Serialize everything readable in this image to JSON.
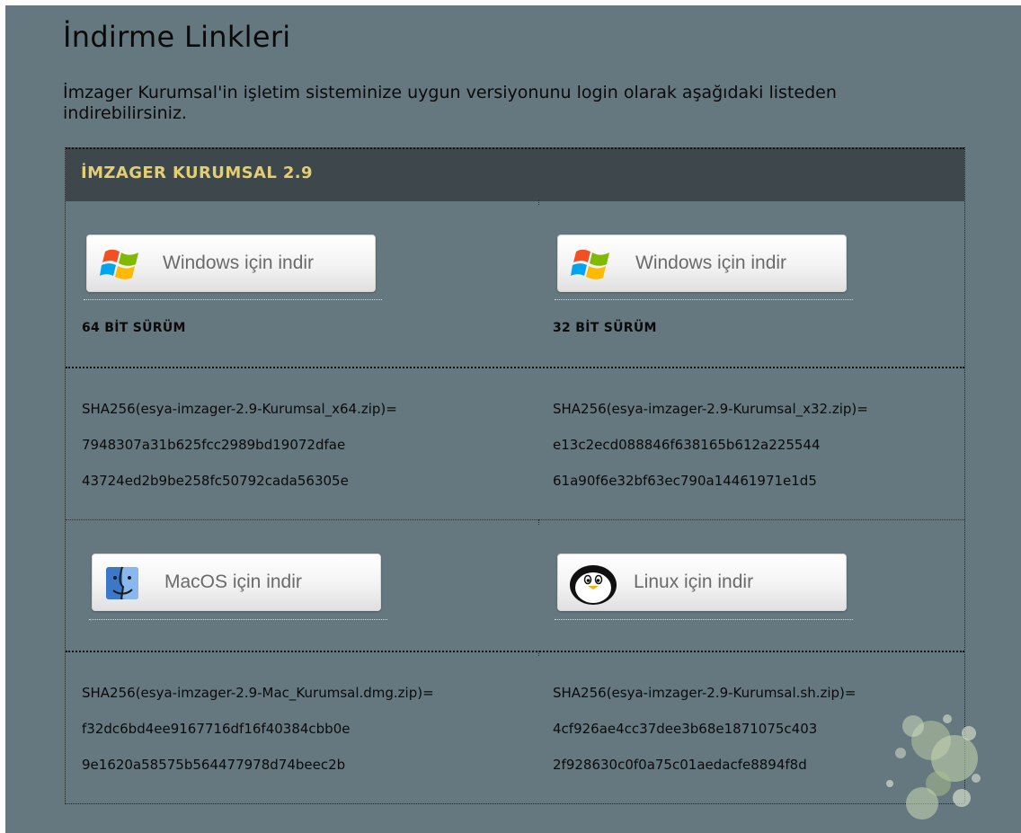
{
  "page": {
    "title": "İndirme Linkleri",
    "intro": "İmzager Kurumsal'in işletim sisteminize uygun versiyonunu login olarak aşağıdaki listeden indirebilirsiniz."
  },
  "section": {
    "header": "İMZAGER KURUMSAL 2.9"
  },
  "downloads": {
    "win64": {
      "button_label": "Windows için indir",
      "version_label": "64 BİT SÜRÜM",
      "icon": "windows-logo-icon"
    },
    "win32": {
      "button_label": "Windows için indir",
      "version_label": "32 BİT SÜRÜM",
      "icon": "windows-logo-icon"
    },
    "mac": {
      "button_label": "MacOS için indir",
      "icon": "mac-finder-icon"
    },
    "linux": {
      "button_label": "Linux için indir",
      "icon": "linux-penguin-icon"
    }
  },
  "hashes": {
    "win64": {
      "label": "SHA256(esya-imzager-2.9-Kurumsal_x64.zip)=",
      "line1": "7948307a31b625fcc2989bd19072dfae",
      "line2": "43724ed2b9be258fc50792cada56305e"
    },
    "win32": {
      "label": "SHA256(esya-imzager-2.9-Kurumsal_x32.zip)=",
      "line1": "e13c2ecd088846f638165b612a225544",
      "line2": "61a90f6e32bf63ec790a14461971e1d5"
    },
    "mac": {
      "label": "SHA256(esya-imzager-2.9-Mac_Kurumsal.dmg.zip)=",
      "line1": "f32dc6bd4ee9167716df16f40384cbb0e",
      "line2": "9e1620a58575b564477978d74beec2b"
    },
    "linux": {
      "label": "SHA256(esya-imzager-2.9-Kurumsal.sh.zip)=",
      "line1": "4cf926ae4cc37dee3b68e1871075c403",
      "line2": "2f928630c0f0a75c01aedacfe8894f8d"
    }
  },
  "colors": {
    "page_background": "#66787f",
    "header_background": "#3e474c",
    "header_text": "#e3cf72"
  }
}
